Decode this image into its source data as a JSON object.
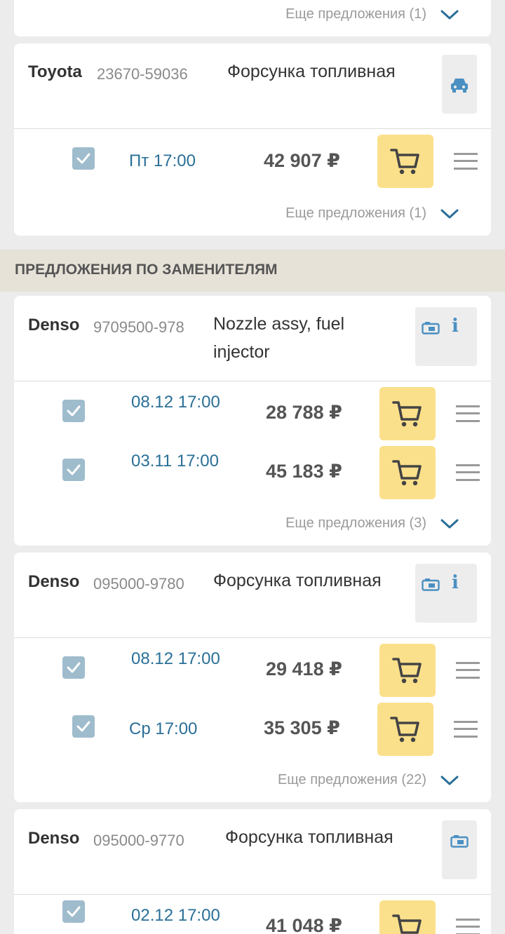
{
  "top_card": {
    "more": "Еще предложения (1)"
  },
  "card1": {
    "brand": "Toyota",
    "code": "23670-59036",
    "desc": "Форсунка топливная",
    "icon": "car-icon",
    "offers": [
      {
        "date": "Пт 17:00",
        "price": "42 907 ₽"
      }
    ],
    "more": "Еще предложения (1)"
  },
  "section": {
    "title": "ПРЕДЛОЖЕНИЯ ПО ЗАМЕНИТЕЛЯМ"
  },
  "card2": {
    "brand": "Denso",
    "code": "9709500-978",
    "desc_line1": "Nozzle assy, fuel",
    "desc_line2": "injector",
    "icons": [
      "camera-icon",
      "info-icon"
    ],
    "info": "i",
    "offers": [
      {
        "date": "08.12 17:00",
        "price": "28 788 ₽"
      },
      {
        "date": "03.11 17:00",
        "price": "45 183 ₽"
      }
    ],
    "more": "Еще предложения (3)"
  },
  "card3": {
    "brand": "Denso",
    "code": "095000-9780",
    "desc": "Форсунка топливная",
    "icons": [
      "camera-icon",
      "info-icon"
    ],
    "info": "i",
    "offers": [
      {
        "date": "08.12 17:00",
        "price": "29 418 ₽"
      },
      {
        "date": "Ср 17:00",
        "price": "35 305 ₽"
      }
    ],
    "more": "Еще предложения (22)"
  },
  "card4": {
    "brand": "Denso",
    "code": "095000-9770",
    "desc": "Форсунка топливная",
    "icons": [
      "camera-icon"
    ],
    "offers": [
      {
        "date": "02.12 17:00",
        "price": "41 048 ₽"
      }
    ]
  },
  "colors": {
    "accent_blue": "#2a6f97",
    "cart_yellow": "#fbe08b",
    "checkbox": "#9fbccd",
    "section_bg": "#e7e2d8"
  }
}
